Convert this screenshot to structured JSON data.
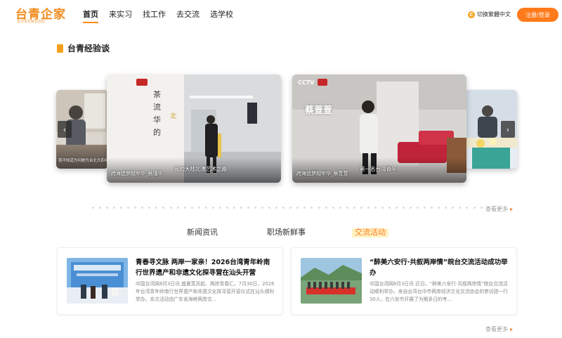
{
  "header": {
    "logo_text": "台青企家",
    "logo_sub": "台湾青年就业创业",
    "nav": [
      "首页",
      "来实习",
      "找工作",
      "去交流",
      "选学校"
    ],
    "lang_switch": "切换繁體中文",
    "login": "注册/登录"
  },
  "experience": {
    "title": "台青经验谈",
    "cards": [
      {
        "caption": "跨海追梦越年华_蔡瑾华"
      },
      {
        "caption": "跨海追梦越年华_蔡萱萱"
      },
      {
        "caption": "我不知道为何她为台北大四年"
      }
    ],
    "overlays": {
      "left_main": "我的大陆北漂艺术之路",
      "right_main": "第一名台湾青年",
      "right_title": "蔡萱萱"
    },
    "more": "查看更多"
  },
  "tabs": [
    "新闻资讯",
    "职场新鲜事",
    "交流活动"
  ],
  "news": [
    {
      "title": "青春寻文脉 两岸一家亲！2026台湾青年岭南行世界遗产和非遗文化探寻营在汕头开营",
      "desc": "中国台湾网8月3日讯 盛夏蒸风起、两岸青春汇。7月30日，2026年台湾青年岭南行世界遗产和非遗文化探寻营开营仪式在汕头顺利举办。本次活动由广东省海峡两岸交..."
    },
    {
      "title": "“醉美六安行·共叙两岸情”皖台交流活动成功举办",
      "desc": "中国台湾网8月3日讯 近日，“醉美六安行·共叙两岸情”皖台交流活动顺利举办。来自台湾台中市两岸经济文化交流协会的参访团一行30人，在六安市开展了为期多日的考..."
    }
  ],
  "news_more": "查看更多",
  "colors": {
    "accent": "#ff7a1a",
    "brand": "#f08a1c"
  }
}
